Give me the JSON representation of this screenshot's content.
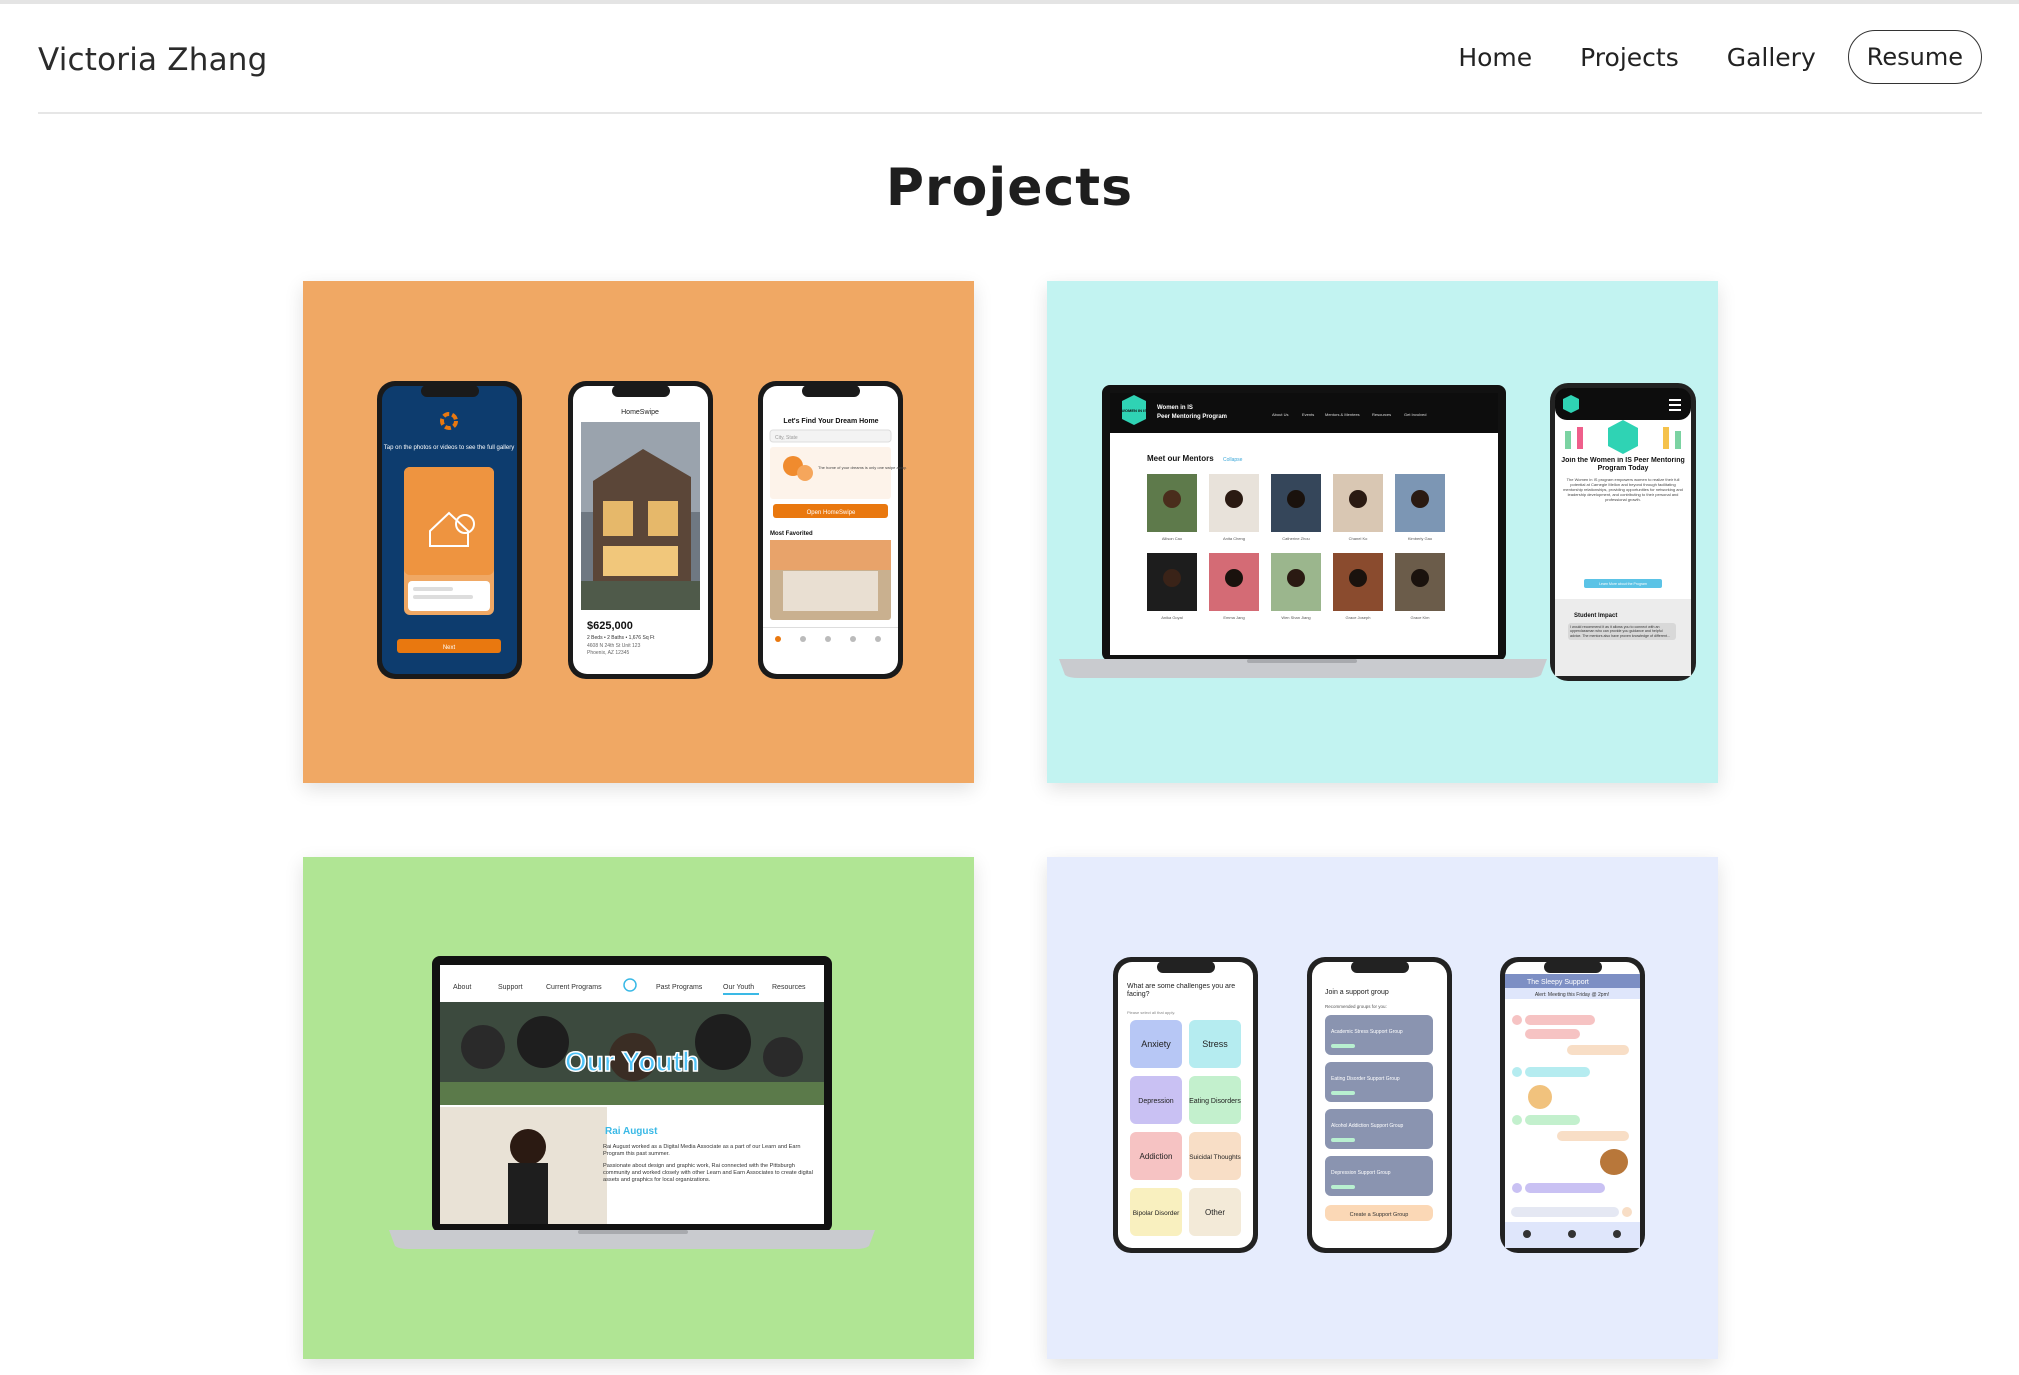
{
  "site": {
    "brand": "Victoria Zhang",
    "nav": [
      "Home",
      "Projects",
      "Gallery"
    ],
    "resume_label": "Resume"
  },
  "page": {
    "title": "Projects"
  },
  "colors": {
    "card1_bg": "#f0a864",
    "card2_bg": "#c2f3f1",
    "card3_bg": "#b0e594",
    "card4_bg": "#e6ecfd",
    "accent_orange": "#e9780f"
  },
  "projects": [
    {
      "screens": {
        "onboarding_text": "Tap on the photos or videos to see the full gallery",
        "onboarding_button": "Next",
        "app_name": "HomeSwipe",
        "price": "$625,000",
        "specs": "2 Beds • 2 Baths • 1,676 Sq Ft",
        "address_1": "4608 N 24th St Unit 123",
        "address_2": "Phoenix, AZ 12345",
        "home_heading": "Let's Find Your Dream Home",
        "search_placeholder": "City, State",
        "promo_text": "The home of your dreams is only one swipe away.",
        "promo_button": "Open HomeSwipe",
        "favorites_heading": "Most Favorited"
      }
    },
    {
      "screens": {
        "logo_text": "WOMEN IN IS",
        "site_title_1": "Women in IS",
        "site_title_2": "Peer Mentoring Program",
        "nav": [
          "About Us",
          "Events",
          "Mentors & Mentees",
          "Resources",
          "Get Involved"
        ],
        "section_heading": "Meet our Mentors",
        "section_link": "Collapse",
        "mentors": [
          "Allison Cao",
          "Anita Cheng",
          "Catherine Zhou",
          "Chanel Ko",
          "Kimberly Gao",
          "Anika Goyal",
          "Emma Jang",
          "Wen Shan Jiang",
          "Grace Joseph",
          "Grace Kim"
        ],
        "mobile_heading": "Join the Women in IS Peer Mentoring Program Today",
        "mobile_body": "The Women in IS program empowers women to realize their full potential at Carnegie Mellon and beyond through facilitating mentorship relationships, providing opportunities for networking and leadership development, and contributing to their personal and professional growth.",
        "mobile_button": "Learn More about the Program",
        "impact_heading": "Student Impact",
        "impact_quote": "I would recommend it as it allows you to connect with an upperclassman who can provide you guidance and helpful advice. The mentors also have proven knowledge of different..."
      }
    },
    {
      "screens": {
        "nav": [
          "About",
          "Support",
          "Current Programs",
          "Past Programs",
          "Our Youth",
          "Resources"
        ],
        "hero_text": "Our Youth",
        "person_name": "Rai August",
        "bio_1": "Rai August worked as a Digital Media Associate as a part of our Learn and Earn Program this past summer.",
        "bio_2": "Passionate about design and graphic work, Rai connected with the Pittsburgh community and worked closely with other Learn and Earn Associates to create digital assets and graphics for local organizations."
      }
    },
    {
      "screens": {
        "question": "What are some challenges you are facing?",
        "question_sub": "Please select all that apply.",
        "options": [
          "Anxiety",
          "Stress",
          "Depression",
          "Eating Disorders",
          "Addiction",
          "Suicidal Thoughts",
          "Bipolar Disorder",
          "Other"
        ],
        "join_heading": "Join a support group",
        "join_sub": "Recommended groups for you:",
        "groups": [
          "Academic Stress Support Group",
          "Eating Disorder Support Group",
          "Alcohol Addiction Support Group",
          "Depression Support Group"
        ],
        "create_button": "Create a Support Group",
        "chat_title": "The Sleepy Support",
        "chat_alert": "Alert: Meeting this Friday @ 2pm!"
      }
    }
  ]
}
